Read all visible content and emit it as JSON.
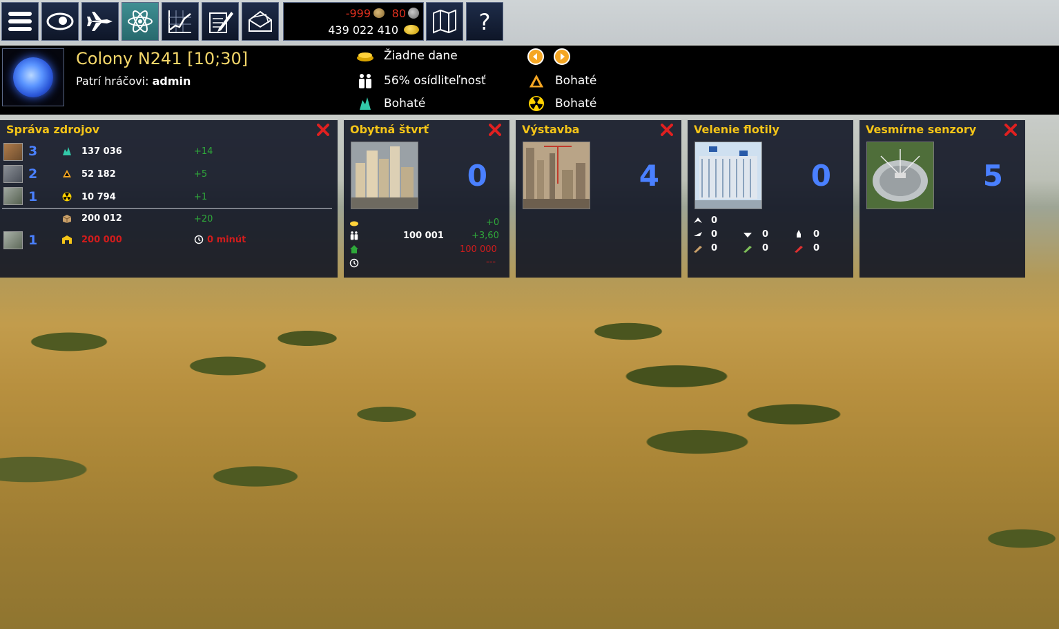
{
  "topbar": {
    "buttons": [
      {
        "name": "menu-button",
        "icon": "hamburger-icon"
      },
      {
        "name": "overview-button",
        "icon": "eye-icon"
      },
      {
        "name": "fleet-button",
        "icon": "jet-icon"
      },
      {
        "name": "research-button",
        "icon": "atom-icon",
        "active": true
      },
      {
        "name": "statistics-button",
        "icon": "chart-icon"
      },
      {
        "name": "notes-button",
        "icon": "pencil-notepad-icon"
      },
      {
        "name": "messages-button",
        "icon": "envelope-icon"
      },
      {
        "name": "map-button",
        "icon": "map-icon"
      },
      {
        "name": "help-button",
        "icon": "question-icon"
      }
    ],
    "resources": {
      "ore_balance": "-999",
      "metal_balance": "80",
      "gold": "439 022 410"
    }
  },
  "colony": {
    "title": "Colony N241 [10;30]",
    "owner_label": "Patrí hráčovi:",
    "owner_name": "admin",
    "taxes": "Žiadne dane",
    "habitability": "56% osídliteľnosť",
    "crystals": "Bohaté",
    "energy": "Bohaté",
    "radiation": "Bohaté"
  },
  "panels": {
    "resources": {
      "title": "Správa zdrojov",
      "rows": [
        {
          "level": "3",
          "amount": "137 036",
          "delta": "+14",
          "icon": "crystal-icon"
        },
        {
          "level": "2",
          "amount": "52 182",
          "delta": "+5",
          "icon": "warning-triangle-icon"
        },
        {
          "level": "1",
          "amount": "10 794",
          "delta": "+1",
          "icon": "radiation-icon"
        }
      ],
      "storage_amount": "200 012",
      "storage_delta": "+20",
      "warehouse_level": "1",
      "warehouse_capacity": "200 000",
      "warehouse_time": "0 minút"
    },
    "housing": {
      "title": "Obytná štvrť",
      "level": "0",
      "gold_delta": "+0",
      "population": "100 001",
      "population_delta": "+3,60",
      "capacity": "100 000",
      "time": "---"
    },
    "construction": {
      "title": "Výstavba",
      "level": "4"
    },
    "fleet": {
      "title": "Velenie flotily",
      "level": "0",
      "ships": [
        "0",
        "0",
        "0",
        "0",
        "0",
        "0",
        "0"
      ]
    },
    "sensors": {
      "title": "Vesmírne senzory",
      "level": "5"
    }
  }
}
